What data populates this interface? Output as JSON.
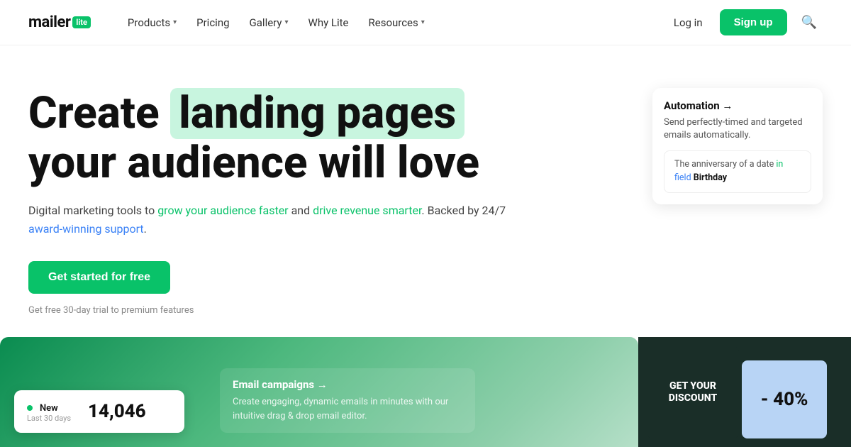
{
  "brand": {
    "name": "mailer",
    "badge": "lite"
  },
  "nav": {
    "links": [
      {
        "label": "Products",
        "has_dropdown": true
      },
      {
        "label": "Pricing",
        "has_dropdown": false
      },
      {
        "label": "Gallery",
        "has_dropdown": true
      },
      {
        "label": "Why Lite",
        "has_dropdown": false
      },
      {
        "label": "Resources",
        "has_dropdown": true
      }
    ],
    "login_label": "Log in",
    "signup_label": "Sign up"
  },
  "hero": {
    "headline_pre": "Create",
    "headline_highlight": "landing pages",
    "headline_post": "your audience will love",
    "subtitle": "Digital marketing tools to grow your audience faster and drive revenue smarter. Backed by 24/7 award-winning support.",
    "cta_label": "Get started for free",
    "trial_note": "Get free 30-day trial to premium features"
  },
  "automation_card": {
    "title": "Automation →",
    "description": "Send perfectly-timed and targeted emails automatically.",
    "snippet_pre": "The anniversary of a date in field",
    "snippet_highlight_green": "in",
    "snippet_highlight_blue": "field",
    "snippet_bold": "Birthday"
  },
  "subscribers_card": {
    "label": "New",
    "meta": "Last 30 days",
    "count": "14,046"
  },
  "email_card": {
    "title": "Email campaigns →",
    "description": "Create engaging, dynamic emails in minutes with our intuitive drag & drop email editor."
  },
  "discount_card": {
    "text": "GET YOUR DISCOUNT",
    "percent": "- 40%"
  }
}
